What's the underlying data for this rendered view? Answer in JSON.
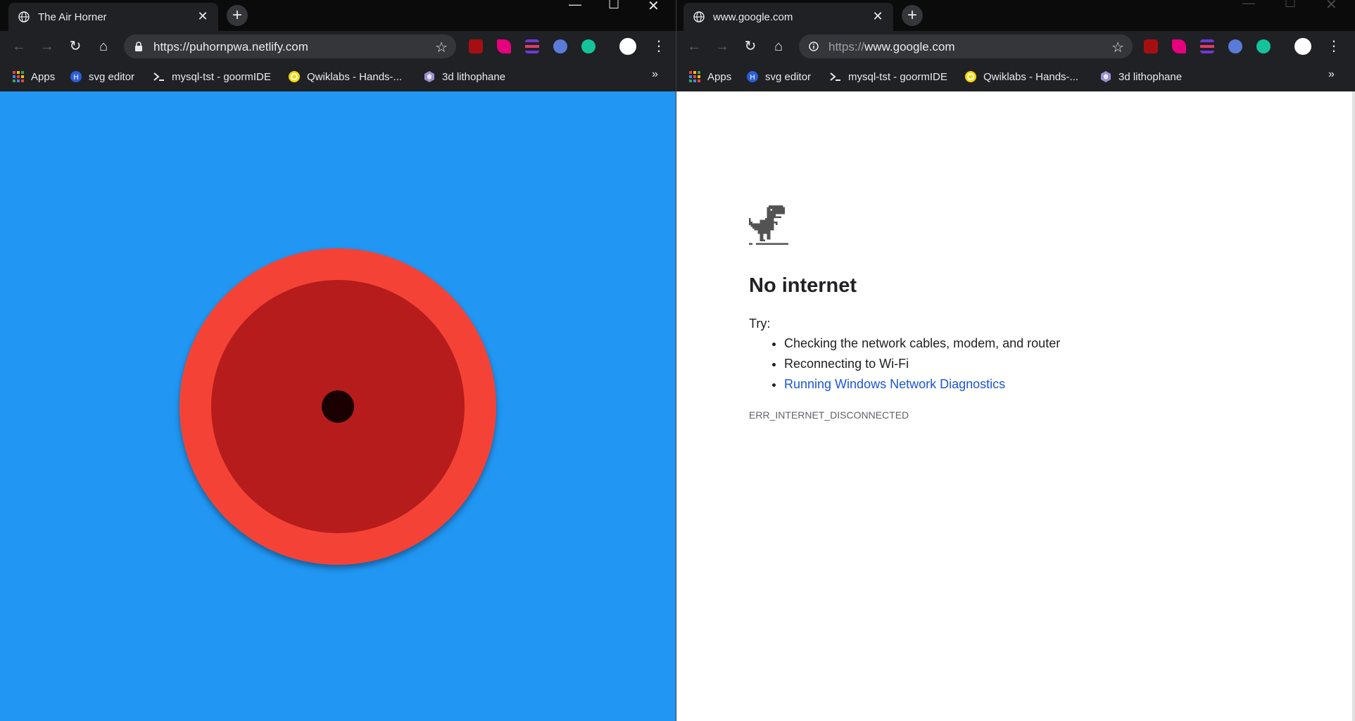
{
  "left_window": {
    "tab": {
      "title": "The Air Horner",
      "favicon": "globe-icon"
    },
    "address": {
      "url": "https://puhornpwa.netlify.com",
      "secure": true
    },
    "bookmarks": [
      {
        "label": "Apps",
        "icon": "apps-grid-icon"
      },
      {
        "label": "svg editor",
        "icon": "svg-editor-icon"
      },
      {
        "label": "mysql-tst - goormIDE",
        "icon": "terminal-icon"
      },
      {
        "label": "Qwiklabs - Hands-...",
        "icon": "qwiklabs-icon"
      },
      {
        "label": "3d lithophane",
        "icon": "lithophane-icon"
      }
    ],
    "content": {
      "background": "#2196f3",
      "horn_outer": "#f44336",
      "horn_inner": "#b71c1c"
    }
  },
  "right_window": {
    "tab": {
      "title": "www.google.com",
      "favicon": "globe-icon"
    },
    "address": {
      "url_prefix": "https://",
      "url_host": "www.google.com",
      "secure": false
    },
    "bookmarks": [
      {
        "label": "Apps",
        "icon": "apps-grid-icon"
      },
      {
        "label": "svg editor",
        "icon": "svg-editor-icon"
      },
      {
        "label": "mysql-tst - goormIDE",
        "icon": "terminal-icon"
      },
      {
        "label": "Qwiklabs - Hands-...",
        "icon": "qwiklabs-icon"
      },
      {
        "label": "3d lithophane",
        "icon": "lithophane-icon"
      }
    ],
    "error_page": {
      "title": "No internet",
      "try_label": "Try:",
      "suggestions": [
        "Checking the network cables, modem, and router",
        "Reconnecting to Wi-Fi"
      ],
      "diagnostics_link": "Running Windows Network Diagnostics",
      "error_code": "ERR_INTERNET_DISCONNECTED"
    }
  },
  "extensions": [
    "ublock-origin-icon",
    "pink-extension-icon",
    "purple-stripes-extension-icon",
    "glasses-extension-icon",
    "grammarly-icon"
  ],
  "colors": {
    "chrome_dark": "#202124",
    "tabstrip": "#0b0b0b",
    "omnibox": "#35363a",
    "link": "#1a56d6"
  }
}
